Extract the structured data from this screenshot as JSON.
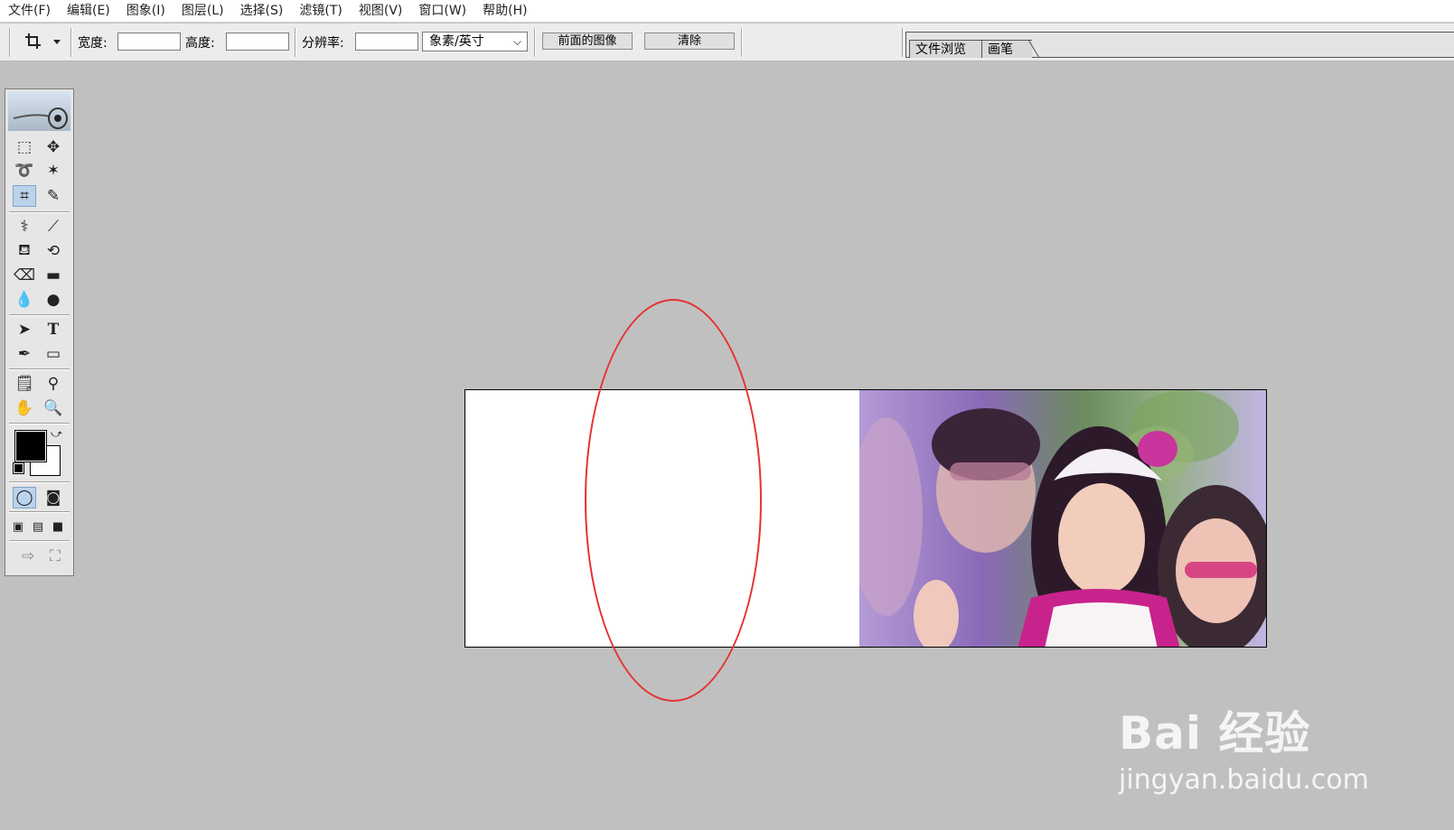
{
  "menu": [
    "文件(F)",
    "编辑(E)",
    "图象(I)",
    "图层(L)",
    "选择(S)",
    "滤镜(T)",
    "视图(V)",
    "窗口(W)",
    "帮助(H)"
  ],
  "options": {
    "width_label": "宽度:",
    "height_label": "高度:",
    "resolution_label": "分辨率:",
    "unit_selected": "象素/英寸",
    "front_image_button": "前面的图像",
    "clear_button": "清除"
  },
  "palette_tabs": [
    "文件浏览",
    "画笔"
  ],
  "toolbox": {
    "icons": [
      "marquee-icon",
      "move-icon",
      "lasso-icon",
      "magic-wand-icon",
      "crop-icon",
      "slice-icon",
      "healing-brush-icon",
      "brush-icon",
      "clone-stamp-icon",
      "history-brush-icon",
      "eraser-icon",
      "gradient-icon",
      "blur-icon",
      "dodge-icon",
      "path-select-icon",
      "text-icon",
      "pen-icon",
      "shape-icon",
      "notes-icon",
      "eyedropper-icon",
      "hand-icon",
      "zoom-icon"
    ],
    "active_tool": "crop-icon",
    "foreground_color": "#000000",
    "background_color": "#ffffff"
  },
  "annotation": {
    "color": "#e53232"
  },
  "watermark": {
    "logo": "Bai 经验",
    "url": "jingyan.baidu.com"
  }
}
